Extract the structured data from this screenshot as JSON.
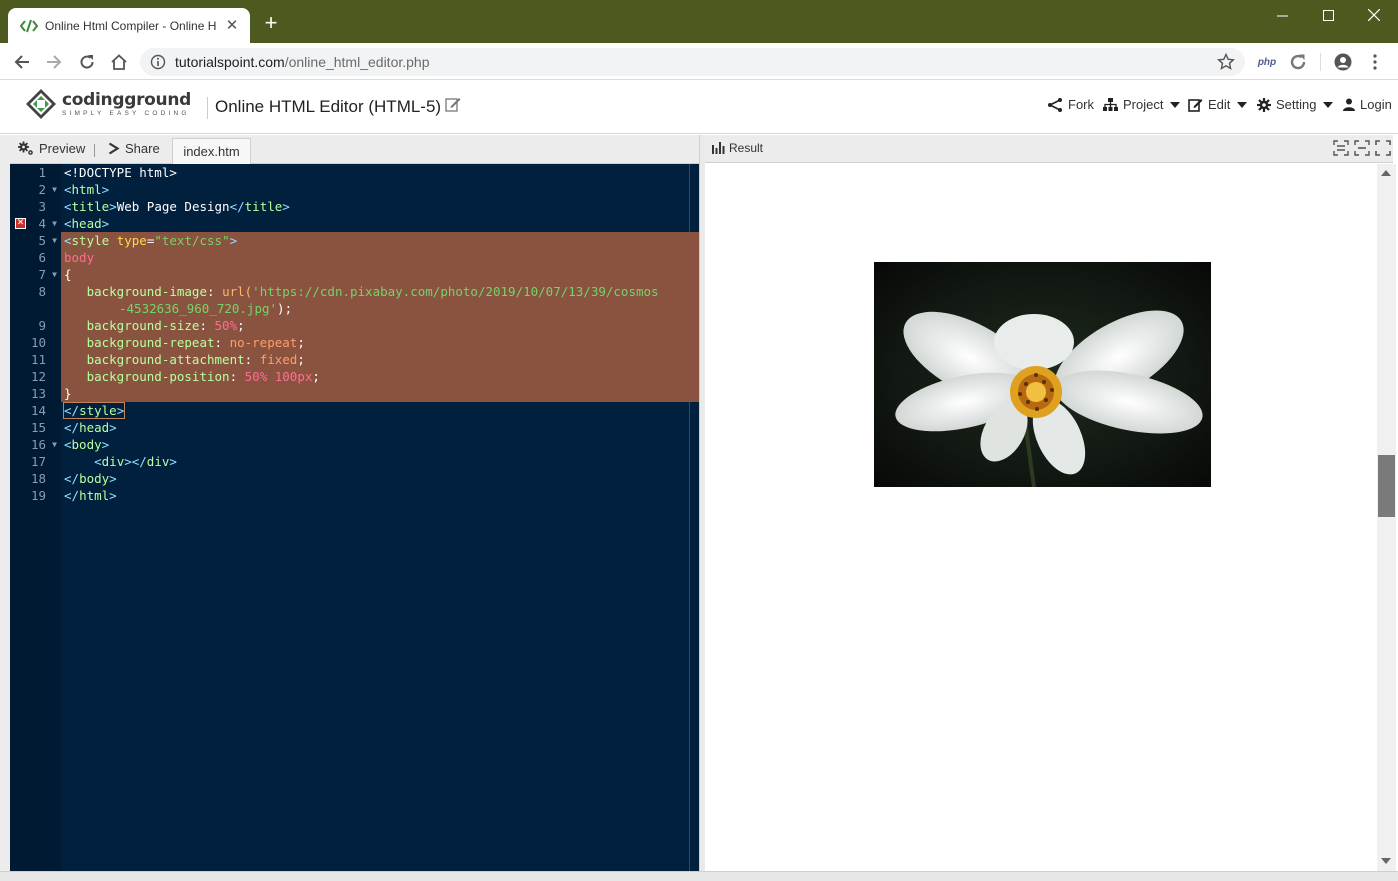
{
  "browser": {
    "tab_title": "Online Html Compiler - Online H",
    "url_host": "tutorialspoint.com",
    "url_path": "/online_html_editor.php",
    "ext_php": "php"
  },
  "site": {
    "brand": "codingground",
    "tagline": "SIMPLY EASY CODING",
    "page_title": "Online HTML Editor (HTML-5)",
    "menu": {
      "fork": "Fork",
      "project": "Project",
      "edit": "Edit",
      "setting": "Setting",
      "login": "Login"
    }
  },
  "editor": {
    "preview_label": "Preview",
    "share_label": "Share",
    "file_tab": "index.htm",
    "lines": [
      {
        "n": "1"
      },
      {
        "n": "2"
      },
      {
        "n": "3"
      },
      {
        "n": "4"
      },
      {
        "n": "5"
      },
      {
        "n": "6"
      },
      {
        "n": "7"
      },
      {
        "n": "8"
      },
      {
        "n": "9"
      },
      {
        "n": "10"
      },
      {
        "n": "11"
      },
      {
        "n": "12"
      },
      {
        "n": "13"
      },
      {
        "n": "14"
      },
      {
        "n": "15"
      },
      {
        "n": "16"
      },
      {
        "n": "17"
      },
      {
        "n": "18"
      },
      {
        "n": "19"
      }
    ],
    "code": {
      "l1": "<!DOCTYPE html>",
      "l2": "html",
      "l3_tag": "title",
      "l3_text": "Web Page Design",
      "l4": "head",
      "l5_tag": "style",
      "l5_attr": "type",
      "l5_val": "\"text/css\"",
      "l6": "body",
      "l7": "{",
      "l8_prop": "background-image",
      "l8_fn": "url(",
      "l8_str1": "'https://cdn.pixabay.com/photo/2019/10/07/13/39/cosmos",
      "l8_str2": "-4532636_960_720.jpg'",
      "l8_end": ");",
      "l9_prop": "background-size",
      "l9_val": "50%",
      "l10_prop": "background-repeat",
      "l10_val": "no-repeat",
      "l11_prop": "background-attachment",
      "l11_val": "fixed",
      "l12_prop": "background-position",
      "l12_val1": "50%",
      "l12_val2": "100px",
      "l13": "}",
      "l14": "style",
      "l15": "head",
      "l16": "body",
      "l17_tag": "div",
      "l18": "body",
      "l19": "html"
    }
  },
  "result": {
    "label": "Result"
  },
  "colors": {
    "titlebar": "#4c5a1f",
    "editor_bg": "#00203e",
    "highlight": "#8a5340"
  }
}
